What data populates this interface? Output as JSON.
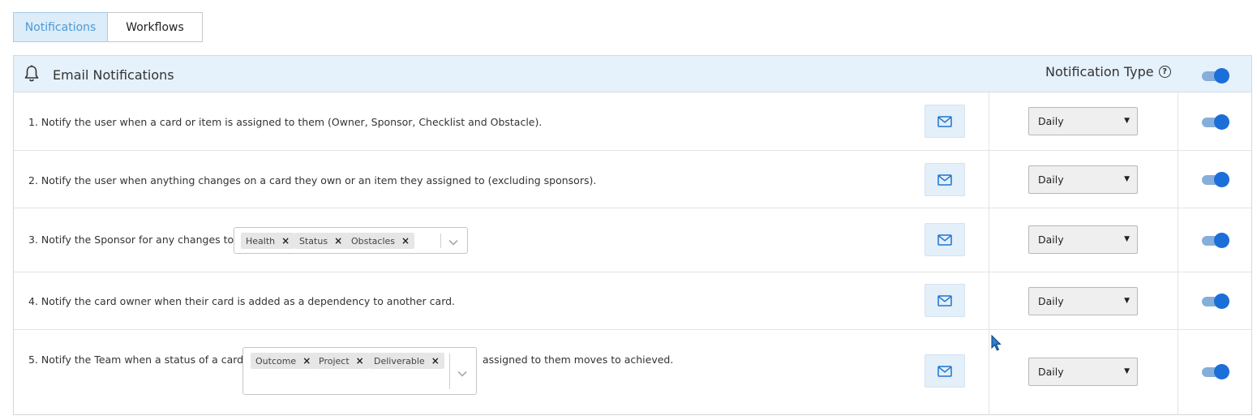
{
  "tabs": [
    {
      "label": "Notifications",
      "active": true
    },
    {
      "label": "Workflows",
      "active": false
    }
  ],
  "panel": {
    "title": "Email Notifications",
    "header_icon": "bell-icon",
    "notification_type_label": "Notification Type",
    "help_icon_glyph": "?",
    "master_toggle_on": true
  },
  "rows": [
    {
      "text": "1. Notify the user when a card or item is assigned to them (Owner, Sponsor, Checklist and Obstacle).",
      "frequency": "Daily",
      "enabled": true
    },
    {
      "text": "2. Notify the user when anything changes on a card they own or an item they assigned to (excluding sponsors).",
      "frequency": "Daily",
      "enabled": true
    },
    {
      "text_before": "3. Notify the Sponsor for any changes to",
      "chips": [
        "Health",
        "Status",
        "Obstacles"
      ],
      "frequency": "Daily",
      "enabled": true
    },
    {
      "text": "4. Notify the card owner when their card is added as a dependency to another card.",
      "frequency": "Daily",
      "enabled": true
    },
    {
      "text_before": "5. Notify the Team when a status of a card",
      "chips": [
        "Outcome",
        "Project",
        "Deliverable"
      ],
      "text_after": "assigned to them moves to achieved.",
      "frequency": "Daily",
      "enabled": true
    }
  ],
  "chip_remove_glyph": "×",
  "select_caret_glyph": "▼",
  "colors": {
    "accent": "#1c6ed8",
    "header_bg": "#e5f1fb",
    "active_tab_text": "#4d9ad6"
  }
}
